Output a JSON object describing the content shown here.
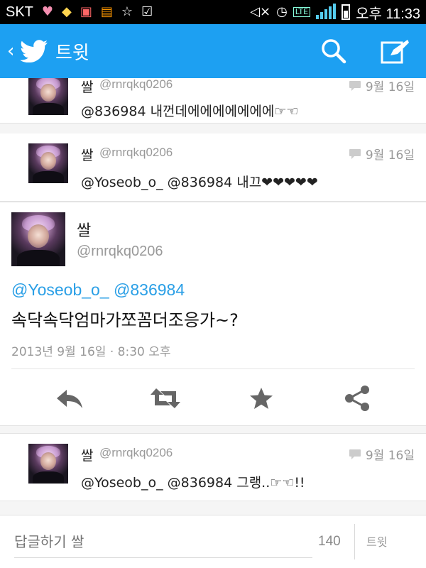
{
  "status_bar": {
    "carrier": "SKT",
    "time": "오후 11:33",
    "network": "LTE",
    "notification_icons": [
      "heart-icon",
      "diamond-icon",
      "calendar-icon",
      "flag-icon",
      "star-icon",
      "clipboard-check-icon"
    ],
    "system_icons": [
      "mute-icon",
      "alarm-icon",
      "lte-icon",
      "signal-icon",
      "battery-icon"
    ]
  },
  "app_bar": {
    "title": "트윗",
    "color": "#1da0f2"
  },
  "replies_above": [
    {
      "name": "쌀",
      "handle": "@rnrqkq0206",
      "date": "9월 16일",
      "text": "@836984 내껀데에에에에에에에☞☜"
    },
    {
      "name": "쌀",
      "handle": "@rnrqkq0206",
      "date": "9월 16일",
      "text": "@Yoseob_o_ @836984 내끄❤❤❤❤❤"
    }
  ],
  "main_tweet": {
    "name": "쌀",
    "handle": "@rnrqkq0206",
    "mentions": "@Yoseob_o_ @836984",
    "text": "속닥속닥엄마가쪼꼼더조응가~?",
    "timestamp": "2013년 9월 16일 · 8:30 오후",
    "mention_color": "#2a9fe6"
  },
  "replies_below": [
    {
      "name": "쌀",
      "handle": "@rnrqkq0206",
      "date": "9월 16일",
      "text": "@Yoseob_o_ @836984 그랭..☞☜!!"
    }
  ],
  "reply_bar": {
    "placeholder": "답글하기 쌀",
    "char_count": "140",
    "tweet_label": "트윗"
  }
}
